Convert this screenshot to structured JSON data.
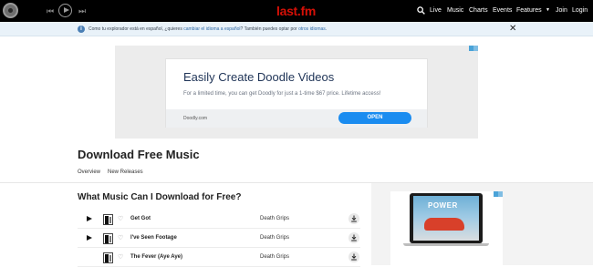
{
  "topbar": {
    "logo": "last.fm",
    "prev_glyph": "⏮",
    "next_glyph": "⏭",
    "nav": [
      {
        "label": "Live"
      },
      {
        "label": "Music"
      },
      {
        "label": "Charts"
      },
      {
        "label": "Events"
      },
      {
        "label": "Features"
      },
      {
        "label": "Join"
      },
      {
        "label": "Login"
      }
    ],
    "caret": "▼",
    "logo_color": "#d51007"
  },
  "notice": {
    "icon": "i",
    "text_before": "Como tu explorador está en español, ¿quieres ",
    "link1": "cambiar el idioma a español",
    "text_middle": "? También puedes optar por ",
    "link2": "otros idiomas",
    "text_after": ".",
    "close": "✕"
  },
  "ad": {
    "title": "Easily Create Doodle Videos",
    "subtitle": "For a limited time, you can get Doodly for just a 1-time $67 price. Lifetime access!",
    "domain": "Doodly.com",
    "cta": "OPEN",
    "cta_color": "#1a8cf0"
  },
  "page": {
    "title": "Download Free Music",
    "subnav": [
      {
        "label": "Overview"
      },
      {
        "label": "New Releases"
      }
    ],
    "section_title": "What Music Can I Download for Free?"
  },
  "tracks": [
    {
      "name": "Get Got",
      "artist": "Death Grips"
    },
    {
      "name": "I've Seen Footage",
      "artist": "Death Grips"
    },
    {
      "name": "The Fever (Aye Aye)",
      "artist": "Death Grips"
    }
  ],
  "side_ad": {
    "promo": "POWER"
  },
  "icons": {
    "heart": "♡"
  }
}
